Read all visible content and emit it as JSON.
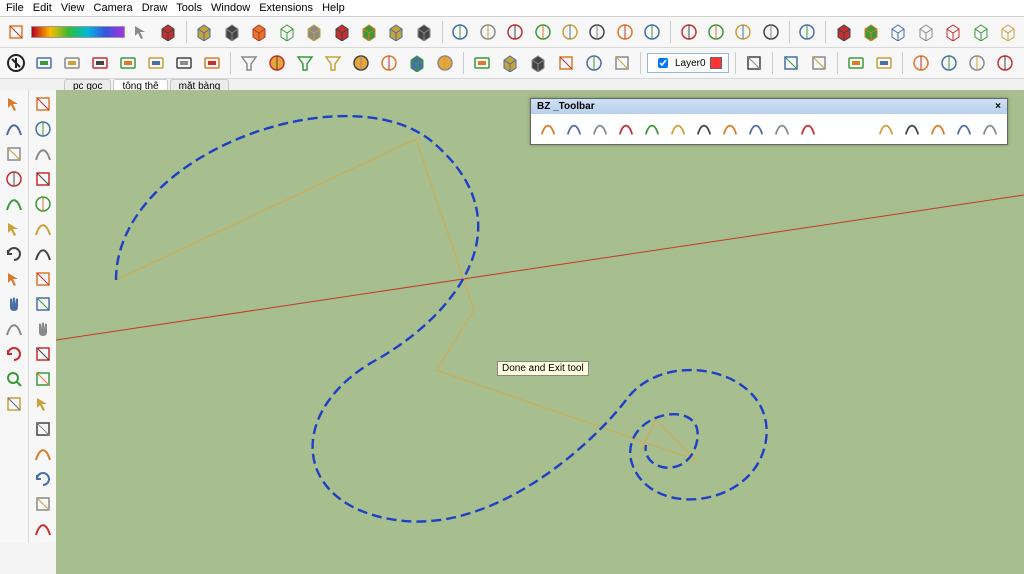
{
  "menu": {
    "items": [
      "File",
      "Edit",
      "View",
      "Camera",
      "Draw",
      "Tools",
      "Window",
      "Extensions",
      "Help"
    ]
  },
  "scene_tabs": {
    "items": [
      "pc goc",
      "tông thê",
      "mặt bàng"
    ],
    "active": 1
  },
  "layer_control": {
    "label": "Layer0",
    "color": "#ff3333"
  },
  "tooltip": {
    "text": "Done and Exit tool"
  },
  "bz_toolbar": {
    "title": "BZ _Toolbar",
    "close": "×"
  },
  "toolbar_row1": {
    "icons": [
      "model-info-icon",
      "gradient-strip",
      "select-icon",
      "sandbox-icon",
      "",
      "cube-orange-icon",
      "cube-gray-icon",
      "cube-brown-icon",
      "cube-line-icon",
      "cube-dashed-icon",
      "cube-shade1-icon",
      "cube-shade2-icon",
      "cube-shade3-icon",
      "cube-shade4-icon",
      "",
      "cylinder-icon",
      "cylinder2-icon",
      "cylinder3-icon",
      "cylinder4-icon",
      "cylinder5-icon",
      "cylinder6-icon",
      "cylinder7-icon",
      "cylinder8-icon",
      "",
      "wheel1-icon",
      "wheel2-icon",
      "wheel3-icon",
      "wheel4-icon",
      "",
      "globe-icon",
      "",
      "house-orange-icon",
      "house-gray-icon",
      "house-line1-icon",
      "house-line2-icon",
      "house-line3-icon",
      "house-line4-icon",
      "house-line5-icon"
    ]
  },
  "toolbar_row2": {
    "icons": [
      "vray-logo-icon",
      "teapot1-icon",
      "teapot2-icon",
      "teapot3-icon",
      "keyboard-icon",
      "microwave-icon",
      "chip-icon",
      "clipboard-icon",
      "",
      "funnel-icon",
      "circle-orange-icon",
      "wedge-icon",
      "tripod-icon",
      "sun-icon",
      "dome-icon",
      "box-icon",
      "sun2-icon",
      "",
      "frame-icon",
      "cube-green-icon",
      "box2-icon",
      "waves-icon",
      "cylinder-green-icon",
      "tool1-icon",
      "",
      "layer-box",
      "",
      "filter-icon",
      "",
      "bars-icon",
      "stat-icon",
      "",
      "gift-icon",
      "gift2-icon",
      "",
      "compass-icon",
      "sphere1-icon",
      "sphere2-icon",
      "sphere3-icon"
    ]
  },
  "palette_a": {
    "icons": [
      "arrow-icon",
      "pencil-red-icon",
      "sheet-icon",
      "clock-icon",
      "arc-icon",
      "move-red-icon",
      "rotate-red-icon",
      "select-red-icon",
      "hand-red-icon",
      "search-icon",
      "orbit-red-icon",
      "eye-icon",
      "footprints-icon"
    ]
  },
  "palette_b": {
    "icons": [
      "diamond-icon",
      "cylinder-red-icon",
      "bezier-icon",
      "scale-icon",
      "protractor-icon",
      "arc-blue-icon",
      "spiral-icon",
      "leaf-icon",
      "door-icon",
      "hand-orange-icon",
      "text-icon",
      "ruler-icon",
      "move-orange-icon",
      "home-icon",
      "search2-icon",
      "refresh-icon",
      "walk-icon",
      "path-icon"
    ]
  },
  "bz_buttons": {
    "icons": [
      "bz-curve1-icon",
      "bz-curve2-icon",
      "bz-curve3-icon",
      "bz-curve4-icon",
      "bz-rect-icon",
      "bz-square-icon",
      "bz-oval-icon",
      "bz-arc1-icon",
      "bz-arc2-icon",
      "bz-arc3-icon",
      "bz-arc4-icon",
      "",
      "bz-node1-icon",
      "bz-node2-icon",
      "bz-node3-icon",
      "bz-node4-icon",
      "bz-node5-icon"
    ]
  },
  "viewport": {
    "bg": "#a7be8e",
    "axis_color": "#c23a2a",
    "construction_color": "#d6a94a",
    "curve_color": "#1e3fc7"
  }
}
